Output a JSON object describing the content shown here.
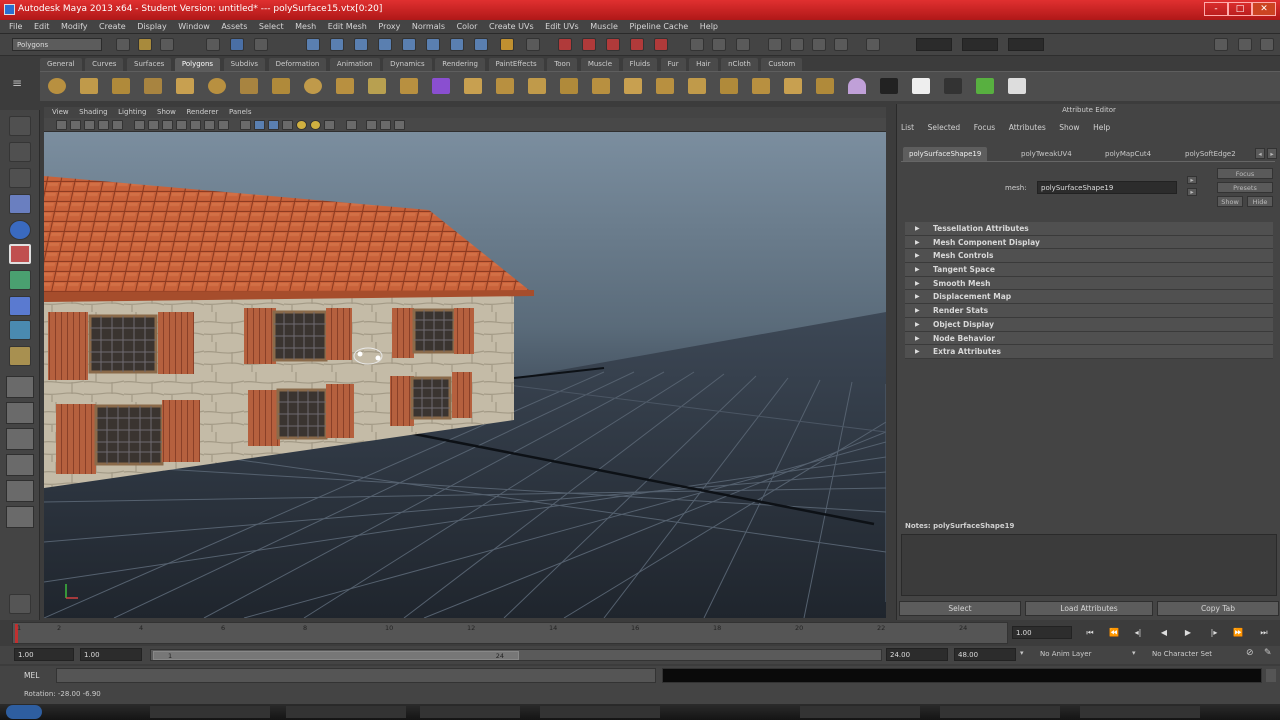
{
  "window": {
    "title": "Autodesk Maya 2013 x64 - Student Version: untitled*   ---   polySurface15.vtx[0:20]",
    "controls": [
      "-",
      "□",
      "✕"
    ]
  },
  "menubar": [
    "File",
    "Edit",
    "Modify",
    "Create",
    "Display",
    "Window",
    "Assets",
    "Select",
    "Mesh",
    "Edit Mesh",
    "Proxy",
    "Normals",
    "Color",
    "Create UVs",
    "Edit UVs",
    "Muscle",
    "Pipeline Cache",
    "Help"
  ],
  "status_line": {
    "mode": "Polygons"
  },
  "shelf": {
    "tabs": [
      "General",
      "Curves",
      "Surfaces",
      "Polygons",
      "Subdivs",
      "Deformation",
      "Animation",
      "Dynamics",
      "Rendering",
      "PaintEffects",
      "Toon",
      "Muscle",
      "Fluids",
      "Fur",
      "Hair",
      "nCloth",
      "Custom"
    ],
    "active_tab": "Polygons"
  },
  "viewport": {
    "panel_menu": [
      "View",
      "Shading",
      "Lighting",
      "Show",
      "Renderer",
      "Panels"
    ]
  },
  "attribute_editor": {
    "title": "Attribute Editor",
    "menu": [
      "List",
      "Selected",
      "Focus",
      "Attributes",
      "Show",
      "Help"
    ],
    "tabs": [
      "polySurfaceShape19",
      "polyTweakUV4",
      "polyMapCut4",
      "polySoftEdge2"
    ],
    "mesh_label": "mesh:",
    "mesh_value": "polySurfaceShape19",
    "focus_label": "Focus",
    "presets_label": "Presets",
    "show_label": "Show",
    "hide_label": "Hide",
    "sections": [
      "Tessellation Attributes",
      "Mesh Component Display",
      "Mesh Controls",
      "Tangent Space",
      "Smooth Mesh",
      "Displacement Map",
      "Render Stats",
      "Object Display",
      "Node Behavior",
      "Extra Attributes"
    ],
    "notes_label": "Notes: polySurfaceShape19",
    "buttons": [
      "Select",
      "Load Attributes",
      "Copy Tab"
    ]
  },
  "time_slider": {
    "ticks": [
      "1",
      "2",
      "4",
      "6",
      "8",
      "10",
      "12",
      "14",
      "16",
      "18",
      "20",
      "22",
      "24"
    ],
    "current_time": "1.00"
  },
  "range_slider": {
    "start": "1.00",
    "anim_start": "1.00",
    "slider_start": "1",
    "slider_end": "24",
    "end": "24.00",
    "anim_end": "48.00",
    "anim_layer": "No Anim Layer",
    "character_set": "No Character Set"
  },
  "command_line": {
    "label": "MEL"
  },
  "help_line": {
    "text": "Rotation: -28.00  -6.90"
  }
}
